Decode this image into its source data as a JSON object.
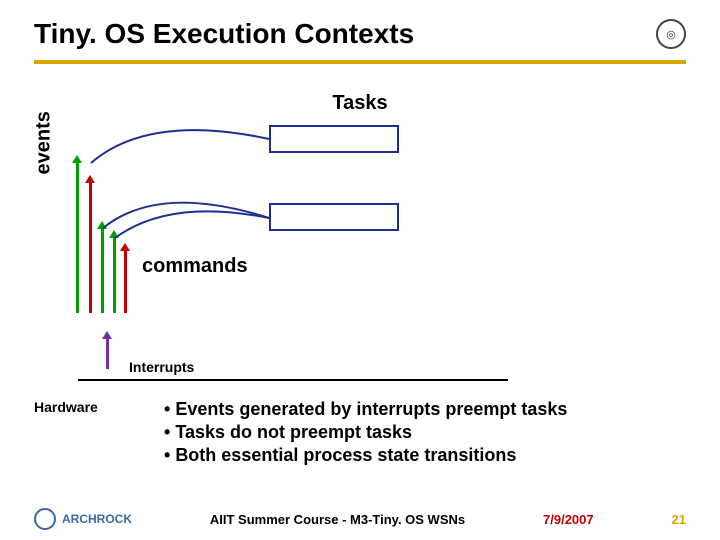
{
  "title": "Tiny. OS Execution Contexts",
  "labels": {
    "tasks": "Tasks",
    "events": "events",
    "commands": "commands",
    "interrupts": "Interrupts",
    "hardware": "Hardware"
  },
  "bullets": [
    "Events generated by interrupts preempt tasks",
    "Tasks do not preempt tasks",
    "Both essential process state transitions"
  ],
  "footer": {
    "logo_text": "ARCHROCK",
    "center": "AIIT Summer Course - M3-Tiny. OS WSNs",
    "date": "7/9/2007",
    "page": "21"
  },
  "chart_data": {
    "type": "diagram",
    "description": "TinyOS execution context layers: hardware interrupts generate events (upward arrows), which call commands; tasks sit at top in two boxes; curved lines from event arrow tips to task boxes.",
    "layers_bottom_to_top": [
      "Hardware",
      "Interrupts",
      "events/commands",
      "Tasks"
    ],
    "event_arrows": {
      "green_count": 3,
      "red_count": 2
    },
    "interrupt_arrows": {
      "purple_count": 1
    },
    "task_boxes": 2
  }
}
